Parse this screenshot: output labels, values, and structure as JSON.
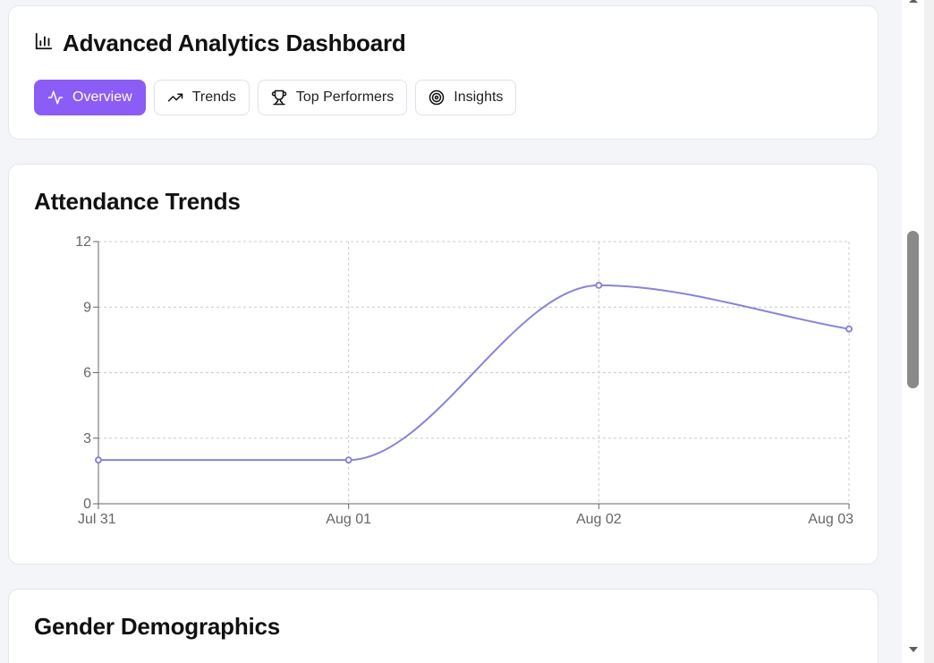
{
  "header": {
    "title": "Advanced Analytics Dashboard",
    "title_icon": "bar-chart-icon"
  },
  "tabs": [
    {
      "label": "Overview",
      "icon": "activity-icon",
      "active": true
    },
    {
      "label": "Trends",
      "icon": "trending-up-icon",
      "active": false
    },
    {
      "label": "Top Performers",
      "icon": "trophy-icon",
      "active": false
    },
    {
      "label": "Insights",
      "icon": "target-icon",
      "active": false
    }
  ],
  "attendance": {
    "title": "Attendance Trends"
  },
  "gender": {
    "title": "Gender Demographics"
  },
  "colors": {
    "accent": "#8b5cf6",
    "line": "#8884d8",
    "grid": "#cccccc"
  },
  "chart_data": {
    "type": "line",
    "title": "Attendance Trends",
    "categories": [
      "Jul 31",
      "Aug 01",
      "Aug 02",
      "Aug 03"
    ],
    "series": [
      {
        "values": [
          2,
          2,
          10,
          8
        ]
      }
    ],
    "yticks": [
      "0",
      "3",
      "6",
      "9",
      "12"
    ],
    "ylim": [
      0,
      12
    ],
    "grid": true,
    "curve": "smooth"
  }
}
